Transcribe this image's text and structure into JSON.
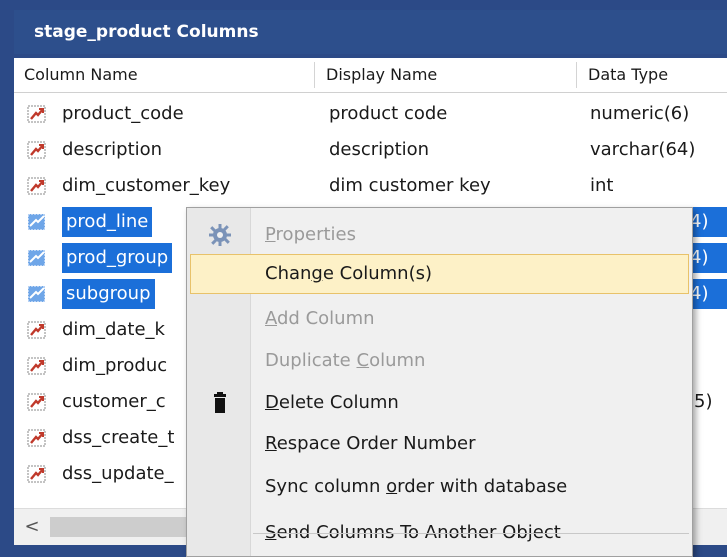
{
  "window": {
    "title": "stage_product Columns"
  },
  "columns": [
    "Column Name",
    "Display Name",
    "Data Type"
  ],
  "rows": [
    {
      "name": "product_code",
      "display": "product code",
      "type": "numeric(6)",
      "selected": false
    },
    {
      "name": "description",
      "display": "description",
      "type": "varchar(64)",
      "selected": false
    },
    {
      "name": "dim_customer_key",
      "display": "dim customer key",
      "type": "int",
      "selected": false
    },
    {
      "name": "prod_line",
      "display": "",
      "type": "4)",
      "selected": true
    },
    {
      "name": "prod_group",
      "display": "",
      "type": "4)",
      "selected": true
    },
    {
      "name": "subgroup",
      "display": "",
      "type": "4)",
      "selected": true
    },
    {
      "name": "dim_date_k",
      "display": "",
      "type": "",
      "selected": false
    },
    {
      "name": "dim_produc",
      "display": "",
      "type": "",
      "selected": false
    },
    {
      "name": "customer_c",
      "display": "",
      "type": "5)",
      "selected": false
    },
    {
      "name": "dss_create_t",
      "display": "",
      "type": "",
      "selected": false
    },
    {
      "name": "dss_update_",
      "display": "",
      "type": "",
      "selected": false
    }
  ],
  "scrollbar": {
    "left_arrow": "<"
  },
  "context_menu": {
    "items": [
      {
        "pre": "",
        "u": "P",
        "post": "roperties",
        "enabled": false,
        "icon": "gear-icon"
      },
      {
        "pre": "Chan",
        "u": "g",
        "post": "e Column(s)",
        "enabled": true,
        "hover": true,
        "icon": ""
      },
      {
        "pre": "",
        "u": "A",
        "post": "dd Column",
        "enabled": false,
        "icon": ""
      },
      {
        "pre": "Duplicate ",
        "u": "C",
        "post": "olumn",
        "enabled": false,
        "icon": ""
      },
      {
        "pre": "",
        "u": "D",
        "post": "elete Column",
        "enabled": true,
        "icon": "trash-icon"
      },
      {
        "pre": "",
        "u": "R",
        "post": "espace Order Number",
        "enabled": true,
        "icon": ""
      },
      {
        "pre": "Sync column ",
        "u": "o",
        "post": "rder with database",
        "enabled": true,
        "icon": ""
      },
      {
        "pre": "",
        "u": "S",
        "post": "end Columns To Another Object",
        "enabled": true,
        "icon": ""
      }
    ]
  },
  "colors": {
    "selection": "#1b6fd9",
    "titlebar": "#2d4f8c",
    "menu_hover": "#fdf1c7"
  }
}
